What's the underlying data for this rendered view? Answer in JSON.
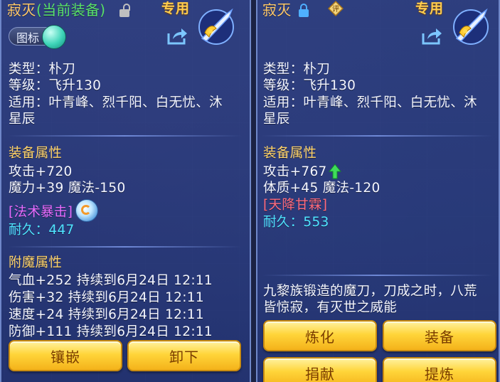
{
  "left": {
    "name": "寂灭",
    "equipped_tag": "(当前装备)",
    "exclusive": "专用",
    "icon_toggle_label": "图标",
    "type_line": "类型：朴刀",
    "level_line": "等级：飞升130",
    "suit_line1": "适用：叶青峰、烈千阳、白无忧、沐",
    "suit_line2": "星辰",
    "attr_header": "装备属性",
    "attrs": [
      "攻击+720",
      "魔力+39 魔法-150"
    ],
    "special": "[法术暴击]",
    "durability": "耐久：447",
    "enchant_header": "附魔属性",
    "enchants": [
      "气血+252 持续到6月24日 12:11",
      "伤害+32 持续到6月24日 12:11",
      "速度+24 持续到6月24日 12:11",
      "防御+111 持续到6月24日 12:11"
    ],
    "buttons": [
      "镶嵌",
      "卸下"
    ]
  },
  "right": {
    "name": "寂灭",
    "eval_label": "评",
    "exclusive": "专用",
    "type_line": "类型：朴刀",
    "level_line": "等级：飞升130",
    "suit_line1": "适用：叶青峰、烈千阳、白无忧、沐",
    "suit_line2": "星辰",
    "attr_header": "装备属性",
    "attrs": [
      "攻击+767",
      "体质+45 魔法-120"
    ],
    "special": "[天降甘霖]",
    "durability": "耐久：553",
    "desc_line1": "九黎族锻造的魔刀，刀成之时，八荒",
    "desc_line2": "皆惊寂，有灭世之威能",
    "buttons": [
      "炼化",
      "装备",
      "捐献",
      "提炼"
    ]
  },
  "colors": {
    "title": "#ffc96a",
    "equipped": "#59e06a",
    "header": "#ffd36a",
    "durability": "#4fe4ff",
    "special_left": "#e86bff",
    "special_right": "#ff6a7a",
    "button": "#ffd53a"
  },
  "icons": [
    "lock-open-icon",
    "lock-closed-icon",
    "share-icon",
    "weapon-icon",
    "swirl-skill-icon",
    "arrow-up-icon",
    "eval-icon"
  ]
}
